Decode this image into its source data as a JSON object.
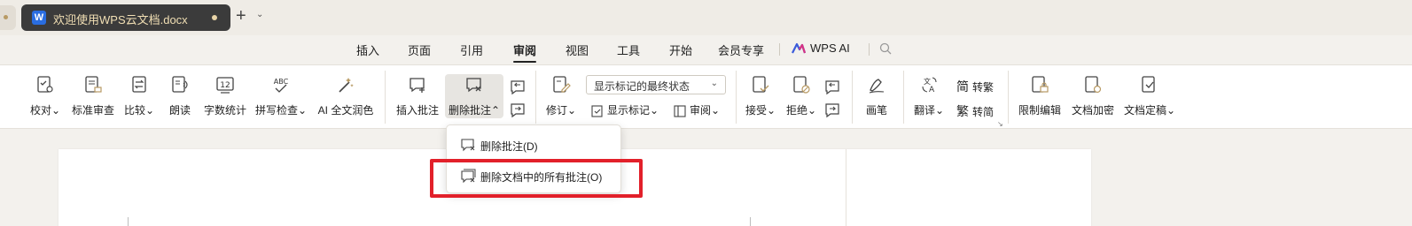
{
  "tabbar": {
    "doc_title": "欢迎使用WPS云文档.docx",
    "app_icon_letter": "W",
    "new_tab": "+",
    "new_tab_menu": "⌄"
  },
  "menu": {
    "items": [
      "插入",
      "页面",
      "引用",
      "审阅",
      "视图",
      "工具",
      "开始",
      "会员专享"
    ],
    "active": "审阅",
    "wps_ai": "WPS AI"
  },
  "ribbon": {
    "buttons": {
      "proofread": "校对",
      "standard_review": "标准审查",
      "compare": "比较",
      "read_aloud": "朗读",
      "word_count": "字数统计",
      "spell_check": "拼写检查",
      "ai_polish": "AI 全文润色",
      "insert_comment": "插入批注",
      "delete_comment": "删除批注",
      "revise": "修订",
      "show_marks": "显示标记",
      "review": "审阅",
      "accept": "接受",
      "reject": "拒绝",
      "pen": "画笔",
      "translate": "翻译",
      "to_traditional": "转繁",
      "to_simplified": "转简",
      "restrict_edit": "限制编辑",
      "encrypt": "文档加密",
      "finalize": "文档定稿"
    },
    "icon_texts": {
      "word_count": "12",
      "spell_check": "ABC",
      "to_traditional": "简",
      "to_simplified": "繁"
    },
    "markup_state": "显示标记的最终状态",
    "dropdown_arrow": "⌄"
  },
  "popup": {
    "items": [
      "删除批注(D)",
      "删除文档中的所有批注(O)"
    ]
  },
  "colors": {
    "highlight": "#e2202a",
    "doc_tab_bg": "#3b3b3b",
    "accent_blue": "#2a6de0"
  }
}
